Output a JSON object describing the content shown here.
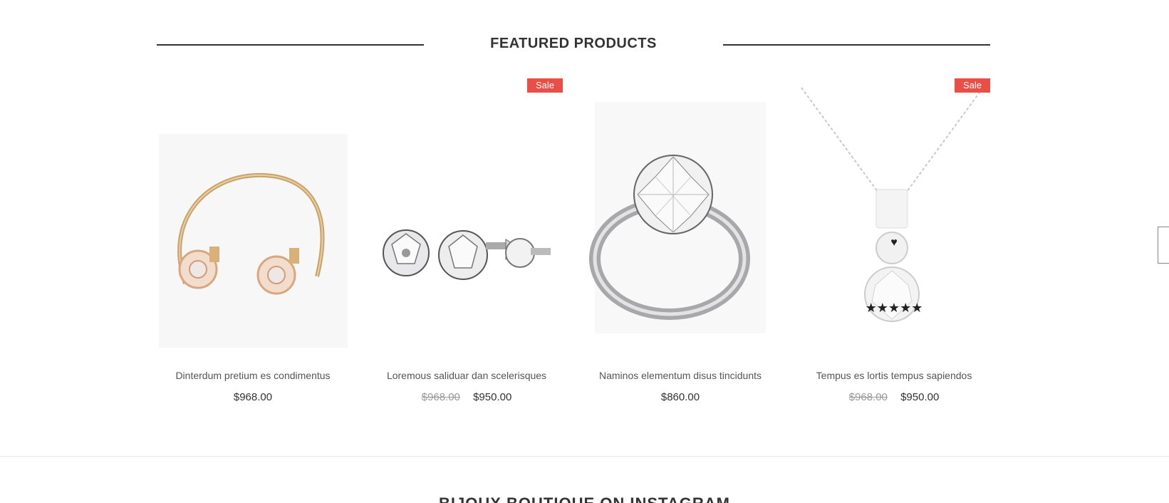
{
  "featured": {
    "title": "FEATURED PRODUCTS"
  },
  "products": [
    {
      "name": "Dinterdum pretium es condimentus",
      "price": "$968.00",
      "old_price": "",
      "sale": false,
      "icon": "bracelet-image"
    },
    {
      "name": "Loremous saliduar dan scelerisques",
      "price": "$950.00",
      "old_price": "$968.00",
      "sale": true,
      "sale_label": "Sale",
      "icon": "earrings-image"
    },
    {
      "name": "Naminos elementum disus tincidunts",
      "price": "$860.00",
      "old_price": "",
      "sale": false,
      "icon": "ring-image"
    },
    {
      "name": "Tempus es lortis tempus sapiendos",
      "price": "$950.00",
      "old_price": "$968.00",
      "sale": true,
      "sale_label": "Sale",
      "icon": "pendant-image",
      "hover": {
        "heart": "♥",
        "stars": "★★★★★"
      }
    }
  ],
  "instagram": {
    "title": "BIJOUX BOUTIQUE ON INSTAGRAM"
  },
  "colors": {
    "sale": "#ea4f47",
    "text": "#333333",
    "muted": "#999999"
  }
}
